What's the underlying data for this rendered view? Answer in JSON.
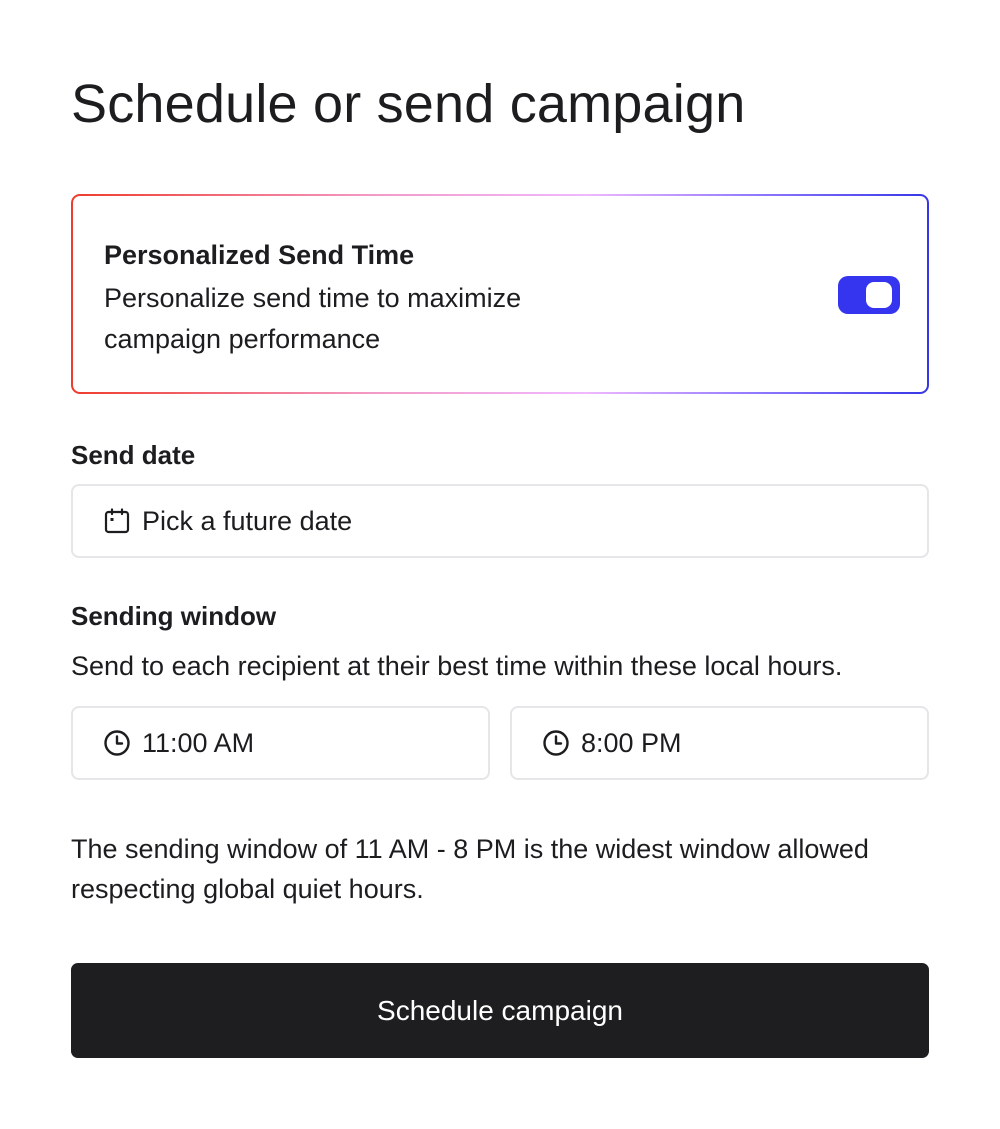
{
  "page": {
    "title": "Schedule or send campaign"
  },
  "personalized_send_time": {
    "title": "Personalized Send Time",
    "description": "Personalize send time to maximize campaign performance",
    "enabled": true
  },
  "send_date": {
    "label": "Send date",
    "placeholder": "Pick a future date",
    "icon": "calendar-icon"
  },
  "sending_window": {
    "label": "Sending window",
    "description": "Send to each recipient at their best time within these local hours.",
    "start_time": "11:00 AM",
    "end_time": "8:00 PM",
    "icon": "clock-icon",
    "note": "The sending window of 11 AM - 8 PM is the widest window allowed respecting global quiet hours."
  },
  "actions": {
    "schedule_label": "Schedule campaign"
  },
  "colors": {
    "toggle_on": "#3535f0",
    "button_bg": "#1e1e20",
    "gradient_start": "#ef3b2c",
    "gradient_end": "#3636e6"
  }
}
